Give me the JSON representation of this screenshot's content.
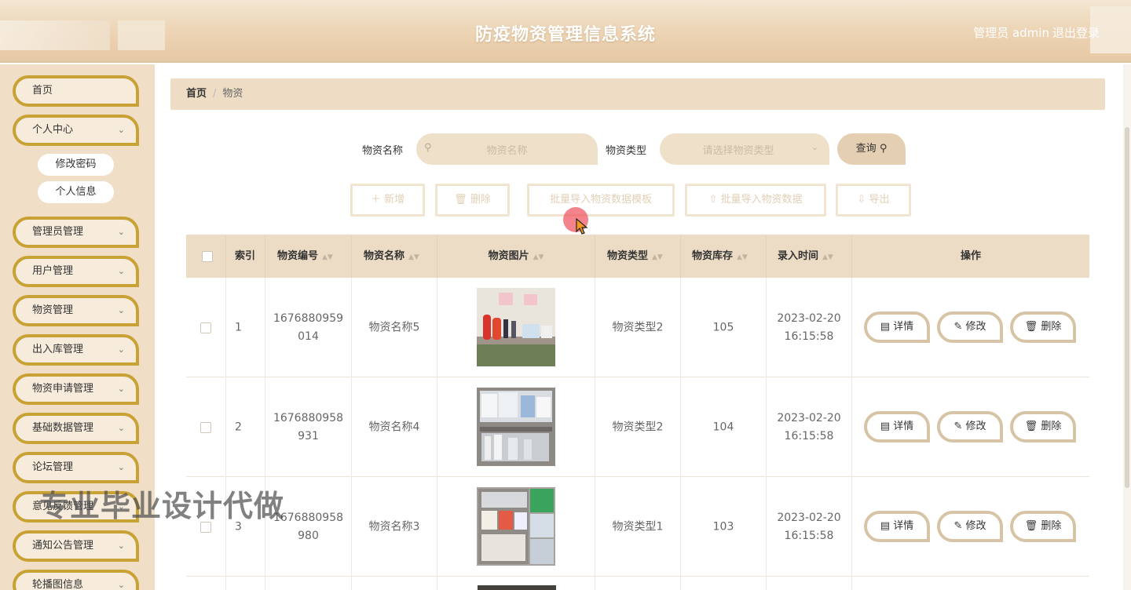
{
  "header": {
    "title": "防疫物资管理信息系统",
    "user": "管理员 admin",
    "logout": "退出登录"
  },
  "sidebar": {
    "items": [
      {
        "label": "首页"
      },
      {
        "label": "个人中心"
      },
      {
        "label": "管理员管理"
      },
      {
        "label": "用户管理"
      },
      {
        "label": "物资管理"
      },
      {
        "label": "出入库管理"
      },
      {
        "label": "物资申请管理"
      },
      {
        "label": "基础数据管理"
      },
      {
        "label": "论坛管理"
      },
      {
        "label": "意见反馈管理"
      },
      {
        "label": "通知公告管理"
      },
      {
        "label": "轮播图信息"
      }
    ],
    "subitems": [
      {
        "label": "修改密码"
      },
      {
        "label": "个人信息"
      }
    ]
  },
  "breadcrumb": {
    "home": "首页",
    "separator": "/",
    "current": "物资"
  },
  "search": {
    "name_label": "物资名称",
    "name_placeholder": "物资名称",
    "type_label": "物资类型",
    "type_placeholder": "请选择物资类型",
    "query_label": "查询"
  },
  "actions": {
    "add": "新增",
    "delete": "删除",
    "template": "批量导入物资数据模板",
    "import": "批量导入物资数据",
    "export": "导出"
  },
  "table": {
    "headers": [
      "索引",
      "物资编号",
      "物资名称",
      "物资图片",
      "物资类型",
      "物资库存",
      "录入时间",
      "操作"
    ],
    "rows": [
      {
        "index": "1",
        "code_a": "1676880959",
        "code_b": "014",
        "name": "物资名称5",
        "type": "物资类型2",
        "stock": "105",
        "date": "2023-02-20",
        "time": "16:15:58"
      },
      {
        "index": "2",
        "code_a": "1676880958",
        "code_b": "931",
        "name": "物资名称4",
        "type": "物资类型2",
        "stock": "104",
        "date": "2023-02-20",
        "time": "16:15:58"
      },
      {
        "index": "3",
        "code_a": "1676880958",
        "code_b": "980",
        "name": "物资名称3",
        "type": "物资类型1",
        "stock": "103",
        "date": "2023-02-20",
        "time": "16:15:58"
      }
    ],
    "op_labels": {
      "detail": "详情",
      "edit": "修改",
      "delete": "删除"
    }
  },
  "watermark": "专业毕业设计代做",
  "colors": {
    "accent_border": "#c9a235",
    "sidebar_bg": "#f0dfc6",
    "header_bg": "#ecd3b3",
    "table_head_bg": "#ecdcc5"
  }
}
